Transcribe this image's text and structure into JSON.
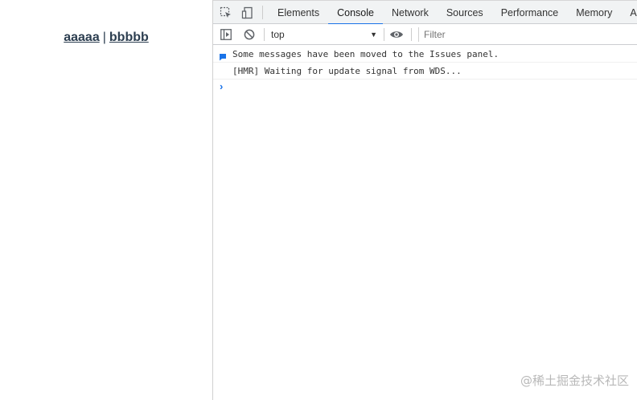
{
  "page": {
    "links": [
      {
        "label": "aaaaa"
      },
      {
        "label": "bbbbb"
      }
    ],
    "separator": "|"
  },
  "devtools": {
    "toolbar_icons": [
      "inspect-element-icon",
      "device-toolbar-icon"
    ],
    "tabs": [
      {
        "label": "Elements",
        "active": false
      },
      {
        "label": "Console",
        "active": true
      },
      {
        "label": "Network",
        "active": false
      },
      {
        "label": "Sources",
        "active": false
      },
      {
        "label": "Performance",
        "active": false
      },
      {
        "label": "Memory",
        "active": false
      },
      {
        "label": "App",
        "active": false
      }
    ],
    "console_bar": {
      "context": "top",
      "filter_placeholder": "Filter"
    },
    "messages": [
      {
        "text": "Some messages have been moved to the Issues panel.",
        "icon": "issues-info-icon"
      },
      {
        "text": "[HMR] Waiting for update signal from WDS...",
        "icon": ""
      }
    ],
    "prompt_symbol": "›"
  },
  "watermark": "@稀土掘金技术社区",
  "colors": {
    "accent": "#1a73e8",
    "link": "#2c3e50",
    "toolbar_bg": "#f1f3f4"
  }
}
